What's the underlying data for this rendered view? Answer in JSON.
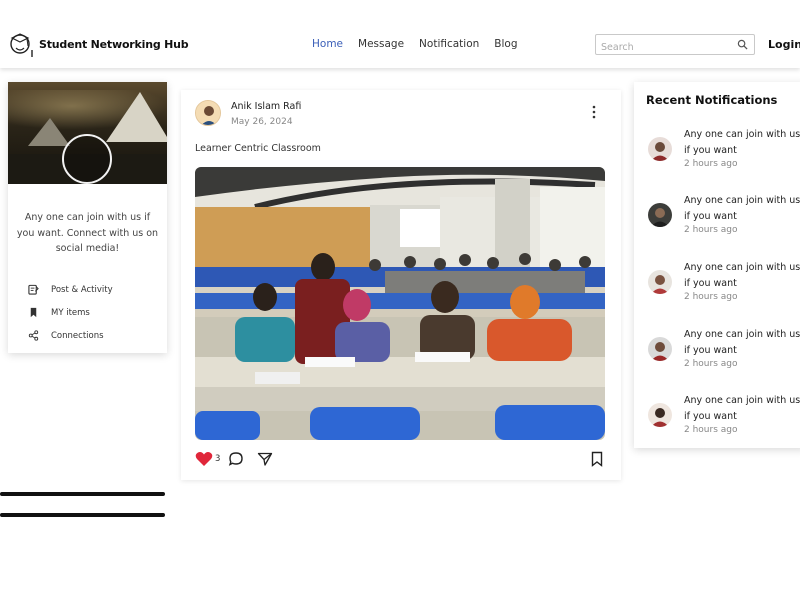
{
  "app": {
    "brand_name": "Student Networking Hub"
  },
  "nav": {
    "links": [
      {
        "label": "Home",
        "active": true
      },
      {
        "label": "Message",
        "active": false
      },
      {
        "label": "Notification",
        "active": false
      },
      {
        "label": "Blog",
        "active": false
      }
    ],
    "search_placeholder": "Search",
    "login_label": "Login"
  },
  "profile": {
    "bio": "Any one can join with us if you want. Connect with us on social media!",
    "menu": [
      {
        "label": "Post & Activity",
        "icon": "post-activity-icon"
      },
      {
        "label": "MY items",
        "icon": "bookmark-icon"
      },
      {
        "label": "Connections",
        "icon": "share-nodes-icon"
      }
    ]
  },
  "post": {
    "author": "Anik Islam Rafi",
    "date": "May 26, 2024",
    "caption": "Learner Centric Classroom",
    "like_count": "3",
    "image_subject": "classroom-photo"
  },
  "notifications": {
    "title": "Recent Notifications",
    "items": [
      {
        "text": "Any one can join with us if you want",
        "time": "2 hours ago"
      },
      {
        "text": "Any one can join with us if you want",
        "time": "2 hours ago"
      },
      {
        "text": "Any one can join with us if you want",
        "time": "2 hours ago"
      },
      {
        "text": "Any one can join with us if you want",
        "time": "2 hours ago"
      },
      {
        "text": "Any one can join with us if you want",
        "time": "2 hours ago"
      }
    ]
  },
  "colors": {
    "accent": "#3b5fb8",
    "like": "#e0263a",
    "corner": "#5a4f8f"
  }
}
